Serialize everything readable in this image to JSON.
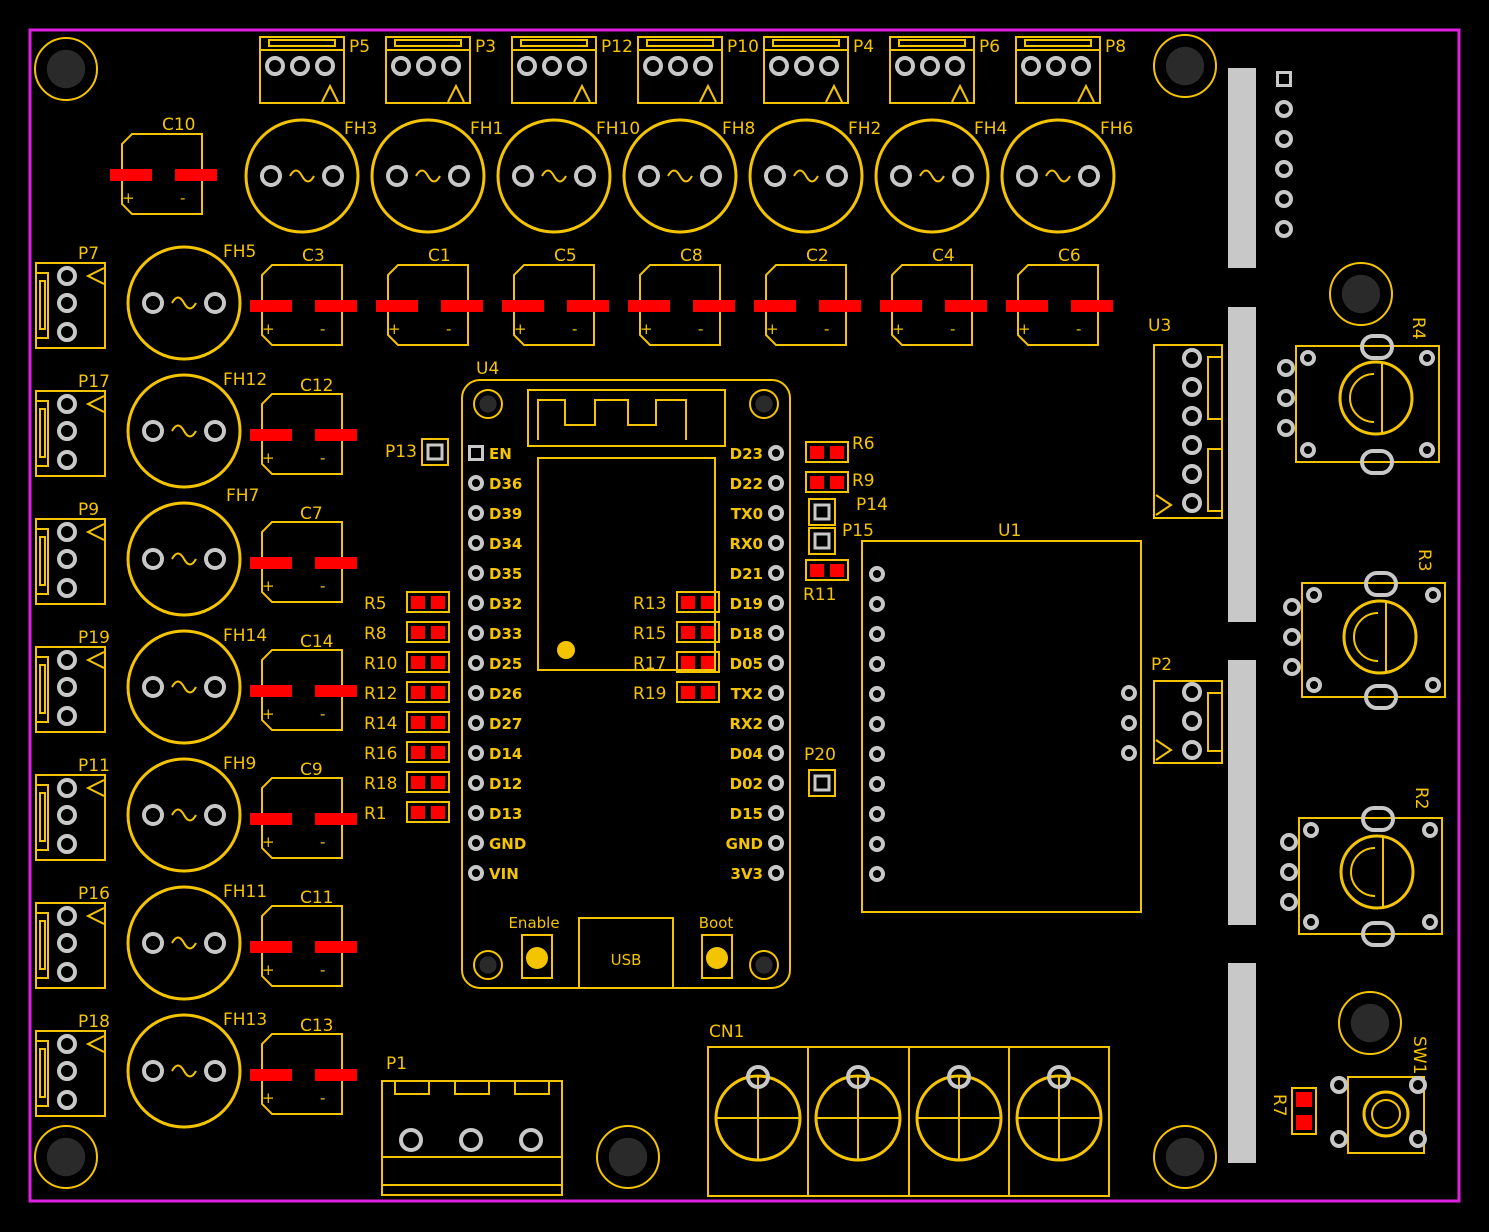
{
  "colors": {
    "background": "#000000",
    "silk": "#f5c400",
    "outline": "#e020e0",
    "pad": "#c8c8c8",
    "smd": "#ff0000",
    "hole": "#2a2a2a"
  },
  "terminals_top": [
    "P5",
    "P3",
    "P12",
    "P10",
    "P4",
    "P6",
    "P8"
  ],
  "fuses_top": [
    "FH3",
    "FH1",
    "FH10",
    "FH8",
    "FH2",
    "FH4",
    "FH6"
  ],
  "caps_row": [
    "C3",
    "C1",
    "C5",
    "C8",
    "C2",
    "C4",
    "C6"
  ],
  "left_rows": [
    {
      "p": "P7",
      "fh": "FH5",
      "c": ""
    },
    {
      "p": "P17",
      "fh": "FH12",
      "c": "C12"
    },
    {
      "p": "P9",
      "fh": "FH7",
      "c": "C7"
    },
    {
      "p": "P19",
      "fh": "FH14",
      "c": "C14"
    },
    {
      "p": "P11",
      "fh": "FH9",
      "c": "C9"
    },
    {
      "p": "P16",
      "fh": "FH11",
      "c": "C11"
    },
    {
      "p": "P18",
      "fh": "FH13",
      "c": "C13"
    }
  ],
  "c10": "C10",
  "u4": {
    "ref": "U4",
    "left_pins": [
      "EN",
      "D36",
      "D39",
      "D34",
      "D35",
      "D32",
      "D33",
      "D25",
      "D26",
      "D27",
      "D14",
      "D12",
      "D13",
      "GND",
      "VIN"
    ],
    "right_pins": [
      "D23",
      "D22",
      "TX0",
      "RX0",
      "D21",
      "D19",
      "D18",
      "D05",
      "TX2",
      "RX2",
      "D04",
      "D02",
      "D15",
      "GND",
      "3V3"
    ],
    "enable": "Enable",
    "boot": "Boot",
    "usb": "USB"
  },
  "resistors_left": [
    "R5",
    "R8",
    "R10",
    "R12",
    "R14",
    "R16",
    "R18",
    "R1"
  ],
  "resistors_mid": [
    "R13",
    "R15",
    "R17",
    "R19"
  ],
  "r6": "R6",
  "r9": "R9",
  "r11": "R11",
  "p13": "P13",
  "p14": "P14",
  "p15": "P15",
  "p20": "P20",
  "u1": "U1",
  "u3": "U3",
  "p2": "P2",
  "p1": "P1",
  "cn1": "CN1",
  "r2": "R2",
  "r3": "R3",
  "r4": "R4",
  "r7": "R7",
  "sw1": "SW1",
  "cap_plus": "+",
  "cap_minus": "-"
}
